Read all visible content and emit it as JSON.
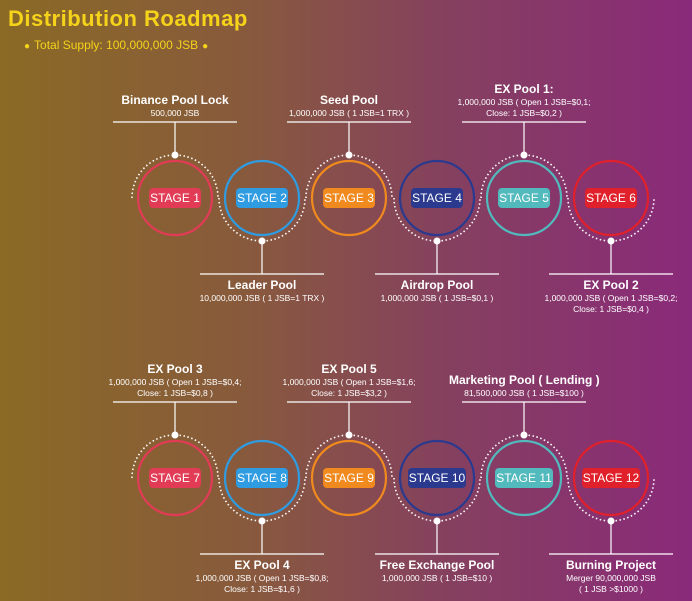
{
  "header": {
    "title": "Distribution Roadmap",
    "subtitle": "Total Supply: 100,000,000 JSB"
  },
  "colors": {
    "title": "#f5d31a",
    "stage1": "#e13b55",
    "stage2": "#2f9be0",
    "stage3": "#f08a1e",
    "stage4": "#2b3a8f",
    "stage5": "#52b9bc",
    "stage6": "#e0202a"
  },
  "stages": [
    {
      "label": "STAGE 1",
      "title": "Binance Pool Lock",
      "detail": [
        "500,000 JSB"
      ]
    },
    {
      "label": "STAGE 2",
      "title": "Leader Pool",
      "detail": [
        "10,000,000 JSB  ( 1 JSB=1 TRX )"
      ]
    },
    {
      "label": "STAGE 3",
      "title": "Seed Pool",
      "detail": [
        "1,000,000 JSB  ( 1 JSB=1 TRX )"
      ]
    },
    {
      "label": "STAGE 4",
      "title": "Airdrop Pool",
      "detail": [
        "1,000,000 JSB  ( 1 JSB=$0,1 )"
      ]
    },
    {
      "label": "STAGE 5",
      "title": "EX Pool 1:",
      "detail": [
        "1,000,000 JSB ( Open 1 JSB=$0,1;",
        "Close: 1 JSB=$0,2 )"
      ]
    },
    {
      "label": "STAGE 6",
      "title": "EX Pool 2",
      "detail": [
        "1,000,000 JSB ( Open 1 JSB=$0,2;",
        "Close: 1 JSB=$0,4 )"
      ]
    },
    {
      "label": "STAGE 7",
      "title": "EX Pool 3",
      "detail": [
        "1,000,000 JSB ( Open 1 JSB=$0,4;",
        "Close: 1 JSB=$0,8 )"
      ]
    },
    {
      "label": "STAGE 8",
      "title": "EX Pool 4",
      "detail": [
        "1,000,000 JSB ( Open 1 JSB=$0,8;",
        "Close: 1 JSB=$1,6 )"
      ]
    },
    {
      "label": "STAGE 9",
      "title": "EX Pool 5",
      "detail": [
        "1,000,000 JSB ( Open 1 JSB=$1,6;",
        "Close: 1 JSB=$3,2 )"
      ]
    },
    {
      "label": "STAGE 10",
      "title": "Free Exchange Pool",
      "detail": [
        "1,000,000 JSB  ( 1 JSB=$10 )"
      ]
    },
    {
      "label": "STAGE 11",
      "title": "Marketing Pool ( Lending )",
      "detail": [
        "81,500,000 JSB ( 1 JSB=$100 )"
      ]
    },
    {
      "label": "STAGE 12",
      "title": "Burning Project",
      "detail": [
        "Merger 90,000,000 JSB",
        "( 1 JSB >$1000 )"
      ]
    }
  ]
}
